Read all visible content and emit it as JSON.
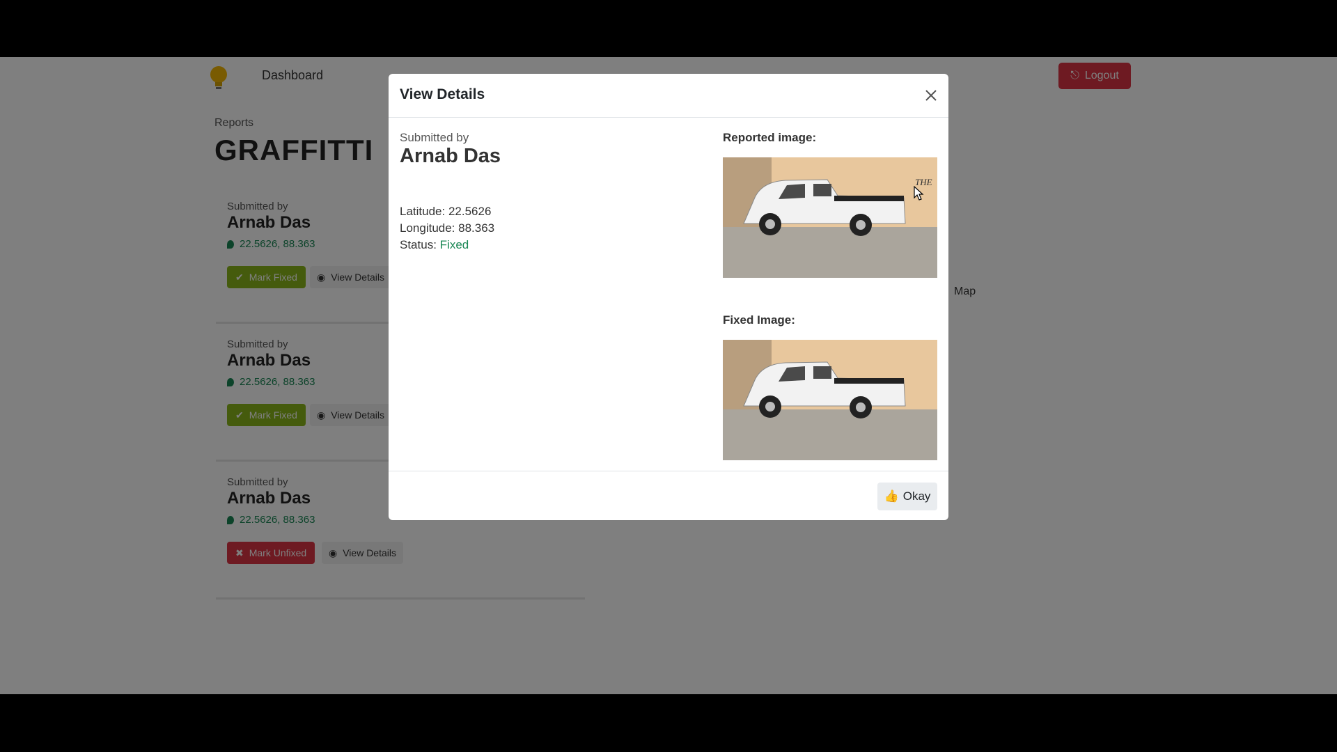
{
  "background": {
    "nav_link": "Dashboard",
    "logout_label": "Logout",
    "breadcrumb": "Reports",
    "page_title": "GRAFFITTI",
    "map_label": "Map",
    "cards": [
      {
        "submitted_label": "Submitted by",
        "name": "Arnab Das",
        "location": "22.5626, 88.363",
        "status_label": "Mark Fixed",
        "view_label": "View Details"
      },
      {
        "submitted_label": "Submitted by",
        "name": "Arnab Das",
        "location": "22.5626, 88.363",
        "status_label": "Mark Fixed",
        "view_label": "View Details"
      },
      {
        "submitted_label": "Submitted by",
        "name": "Arnab Das",
        "location": "22.5626, 88.363",
        "status_label": "Mark Unfixed",
        "view_label": "View Details"
      }
    ]
  },
  "modal": {
    "title": "View Details",
    "submitted_label": "Submitted by",
    "submitter_name": "Arnab Das",
    "latitude_label": "Latitude:",
    "latitude": "22.5626",
    "longitude_label": "Longitude:",
    "longitude": "88.363",
    "status_label": "Status:",
    "status": "Fixed",
    "reported_image_label": "Reported image:",
    "fixed_image_label": "Fixed Image:",
    "okay_label": "Okay",
    "graffiti_text": "THE"
  },
  "colors": {
    "status_fixed": "#198754",
    "danger": "#dc3545",
    "mark_fixed": "#8ab71a"
  }
}
